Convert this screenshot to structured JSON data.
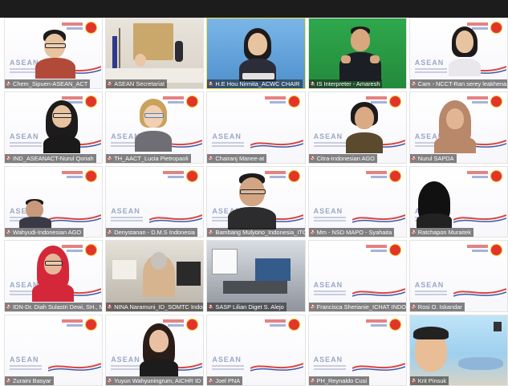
{
  "meeting": {
    "colors": {
      "topbar": "#1c1c1c",
      "active_speaker": "#f2e94e",
      "name_bar": "rgba(30,30,30,.55)",
      "asean_red": "#e2342a"
    }
  },
  "participants": [
    {
      "name": "Chem_Sipuen-ASEAN_ACT",
      "view": "asean-man-glasses"
    },
    {
      "name": "ASEAN Secretariat",
      "view": "secretariat-room"
    },
    {
      "name": "H.E Hou Nirmita_ACWC CHAIR",
      "view": "blue-woman",
      "speaking": true
    },
    {
      "name": "IS Interpreter - Amaresh",
      "view": "green-signer"
    },
    {
      "name": "Cam - NCCT-Ran serey leakhena",
      "view": "asean-woman"
    },
    {
      "name": "IND_ASEANACT-Nurul Qoriah",
      "view": "asean-woman-glasses"
    },
    {
      "name": "TH_AACT_Lucia Pietropaoli",
      "view": "asean-woman-blonde"
    },
    {
      "name": "Chairanj Manee-at",
      "view": "asean-empty"
    },
    {
      "name": "Citra-Indonesian AGO",
      "view": "asean-woman-uniform"
    },
    {
      "name": "Nurul SAPDA",
      "view": "asean-woman-hijab"
    },
    {
      "name": "Wahyudi-Indonesian AGO",
      "view": "asean-man-partial"
    },
    {
      "name": "Denystanan - D.M.S Indonesia",
      "view": "asean-empty"
    },
    {
      "name": "Bambang Mulyono_Indonesia_ITC",
      "view": "asean-man-glasses2"
    },
    {
      "name": "Mm - NSD MAPO - Syahaita",
      "view": "asean-empty"
    },
    {
      "name": "Ratchapon Muraitek",
      "view": "asean-woman-dark"
    },
    {
      "name": "IDN-Dr. Diah Sulastri Dewi, SH., M.",
      "view": "asean-woman-redhijab"
    },
    {
      "name": "NINA Naramuni_ID_SOMTC Indon",
      "view": "office-woman"
    },
    {
      "name": "SASP Lilian Diget S. Alejo",
      "view": "lab-desk"
    },
    {
      "name": "Francisca Sherianie_ICHAT INDON...",
      "view": "asean-empty"
    },
    {
      "name": "Rosi O. Iskandar",
      "view": "asean-empty"
    },
    {
      "name": "Zuraini Basyar",
      "view": "asean-empty"
    },
    {
      "name": "Yuyun Wahyuningrum, AICHR ID",
      "view": "asean-woman-long"
    },
    {
      "name": "Joel PNA",
      "view": "asean-empty"
    },
    {
      "name": "PH_Reynaldo Cusi",
      "view": "asean-empty"
    },
    {
      "name": "Krit Pinsuk",
      "view": "sky-kid"
    }
  ],
  "background_text": {
    "asean_word": "ASEAN"
  }
}
